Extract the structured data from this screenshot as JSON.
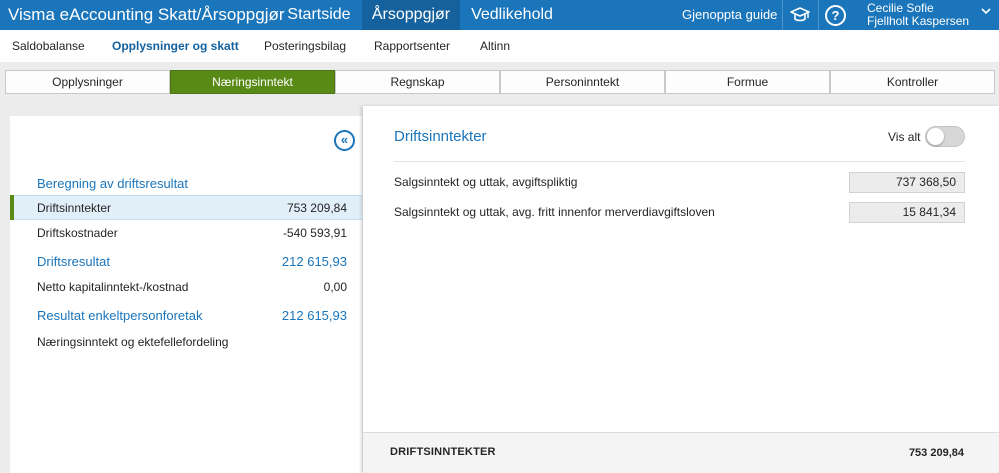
{
  "app": {
    "title": "Visma eAccounting Skatt/Årsoppgjør",
    "nav": [
      {
        "label": "Startside",
        "active": false
      },
      {
        "label": "Årsoppgjør",
        "active": true
      },
      {
        "label": "Vedlikehold",
        "active": false
      }
    ],
    "guide_button": "Gjenoppta guide",
    "icons": [
      "graduation-cap-icon",
      "help-icon",
      "chevron-down-icon"
    ],
    "help_glyph": "?",
    "user": {
      "name": "Cecilie Sofie Fjellholt Kaspersen"
    },
    "brand_color": "#1a75bb"
  },
  "subnav": {
    "items": [
      {
        "label": "Saldobalanse",
        "active": false
      },
      {
        "label": "Opplysninger og skatt",
        "active": true
      },
      {
        "label": "Posteringsbilag",
        "active": false
      },
      {
        "label": "Rapportsenter",
        "active": false
      },
      {
        "label": "Altinn",
        "active": false
      }
    ]
  },
  "tabs": [
    {
      "label": "Opplysninger",
      "active": false
    },
    {
      "label": "Næringsinntekt",
      "active": true
    },
    {
      "label": "Regnskap",
      "active": false
    },
    {
      "label": "Personinntekt",
      "active": false
    },
    {
      "label": "Formue",
      "active": false
    },
    {
      "label": "Kontroller",
      "active": false
    }
  ],
  "tab_accent_color": "#5a8a16",
  "left_panel": {
    "collapse_icon": "double-chevron-left-icon",
    "collapse_glyph": "«",
    "section_title": "Beregning av driftsresultat",
    "rows": [
      {
        "label": "Driftsinntekter",
        "value": "753 209,84",
        "selected": true,
        "style": "normal"
      },
      {
        "label": "Driftskostnader",
        "value": "-540 593,91",
        "selected": false,
        "style": "normal"
      },
      {
        "label": "Driftsresultat",
        "value": "212 615,93",
        "selected": false,
        "style": "blue"
      },
      {
        "label": "Netto kapitalinntekt-/kostnad",
        "value": "0,00",
        "selected": false,
        "style": "normal"
      },
      {
        "label": "Resultat enkeltpersonforetak",
        "value": "212 615,93",
        "selected": false,
        "style": "blue"
      },
      {
        "label": "Næringsinntekt og ektefellefordeling",
        "value": "",
        "selected": false,
        "style": "normal"
      }
    ]
  },
  "right_panel": {
    "title": "Driftsinntekter",
    "vis_alt": {
      "label": "Vis alt",
      "on": false
    },
    "fields": [
      {
        "label": "Salgsinntekt og uttak, avgiftspliktig",
        "value": "737 368,50"
      },
      {
        "label": "Salgsinntekt og uttak, avg. fritt innenfor merverdiavgiftsloven",
        "value": "15 841,34"
      }
    ],
    "footer": {
      "label": "DRIFTSINNTEKTER",
      "value": "753 209,84"
    }
  }
}
